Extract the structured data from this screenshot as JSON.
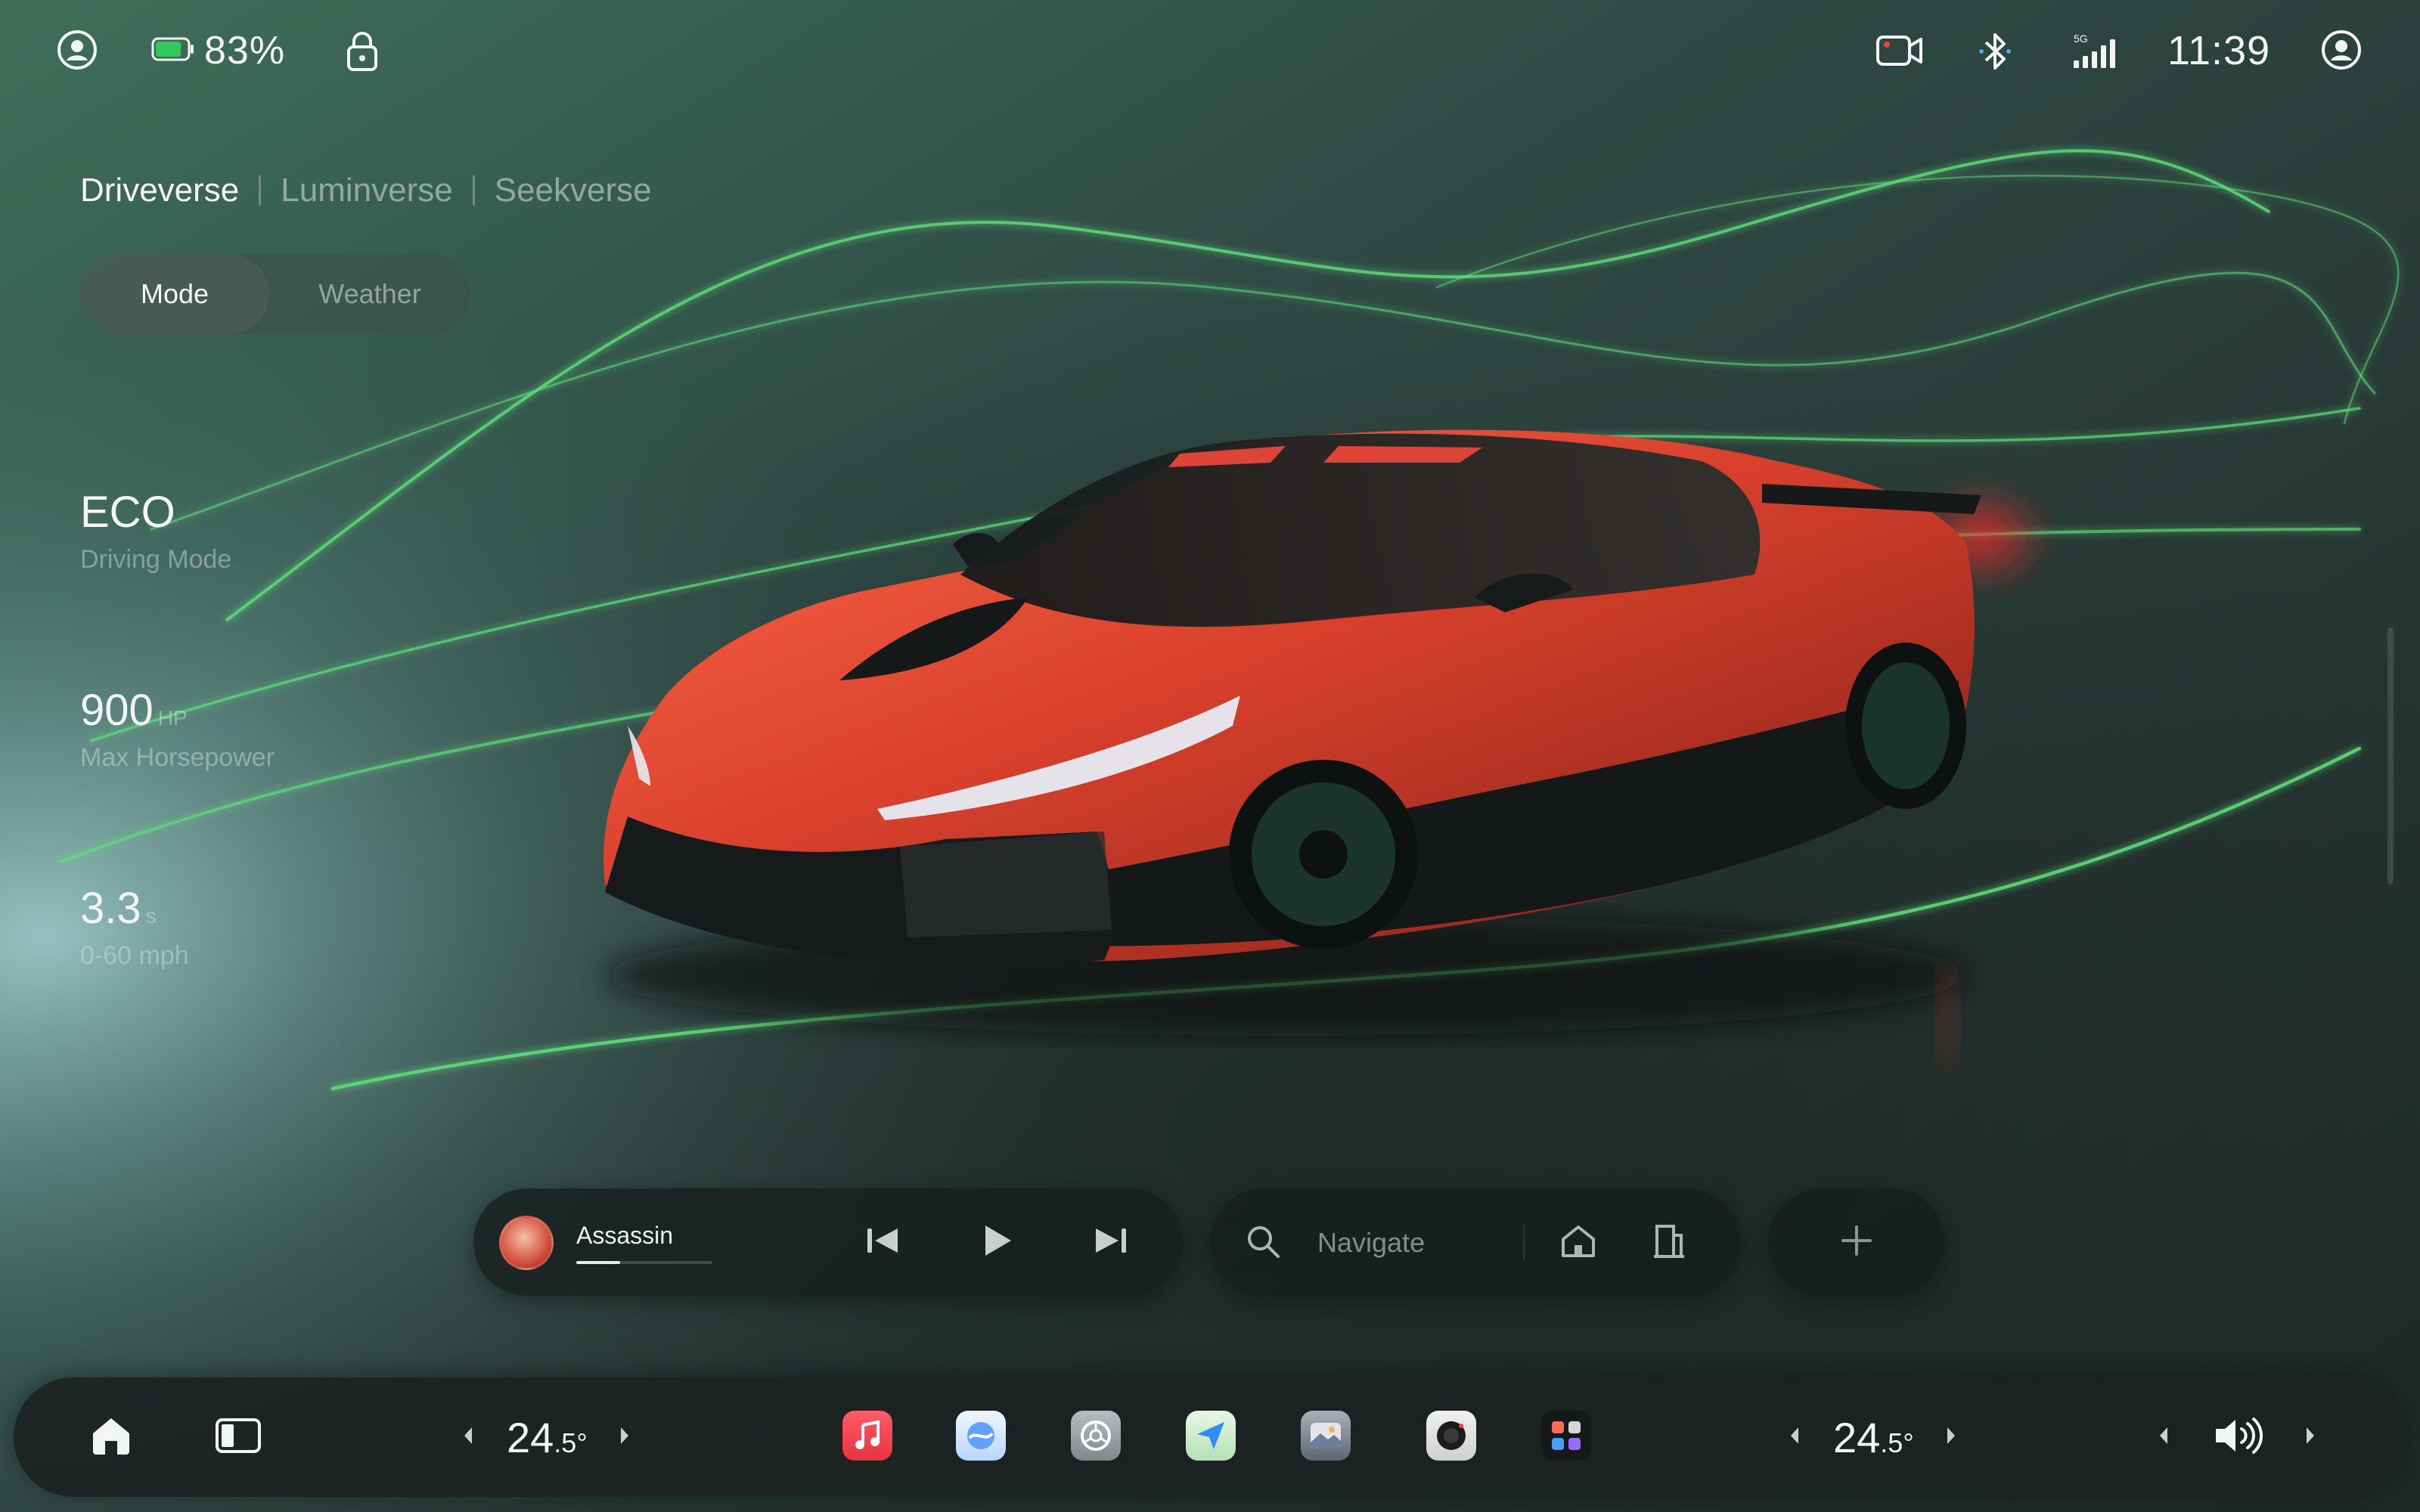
{
  "status_bar": {
    "battery_percent": "83%",
    "battery_level": 0.83,
    "network_label": "5G",
    "time": "11:39"
  },
  "verse_tabs": [
    "Driveverse",
    "Luminverse",
    "Seekverse"
  ],
  "segmented": {
    "mode": "Mode",
    "weather": "Weather"
  },
  "stats": {
    "drive_mode": {
      "value": "ECO",
      "label": "Driving Mode"
    },
    "horsepower": {
      "value": "900",
      "unit": "HP",
      "label": "Max Horsepower"
    },
    "acceleration": {
      "value": "3.3",
      "unit": "s",
      "label": "0-60 mph"
    }
  },
  "media": {
    "track": "Assassin",
    "progress": 0.32
  },
  "navigation": {
    "placeholder": "Navigate"
  },
  "climate": {
    "left": {
      "whole": "24",
      "decimal": ".5°"
    },
    "right": {
      "whole": "24",
      "decimal": ".5°"
    }
  },
  "icons": {
    "status": [
      "user-icon",
      "battery-icon",
      "lock-icon",
      "camera-icon",
      "bluetooth-icon",
      "signal-icon",
      "profile-icon"
    ],
    "media": [
      "previous-icon",
      "play-icon",
      "next-icon"
    ],
    "nav": [
      "search-icon",
      "home-icon",
      "office-icon"
    ],
    "dock": [
      "home-icon",
      "split-view-icon",
      "music-app-icon",
      "weather-app-icon",
      "settings-app-icon",
      "maps-app-icon",
      "gallery-app-icon",
      "camera-app-icon",
      "apps-grid-icon",
      "volume-icon"
    ]
  },
  "colors": {
    "accent_green": "#5ee07a",
    "car_red": "#d8402c",
    "battery_green": "#34c759",
    "dock_bg": "#1c2221"
  }
}
